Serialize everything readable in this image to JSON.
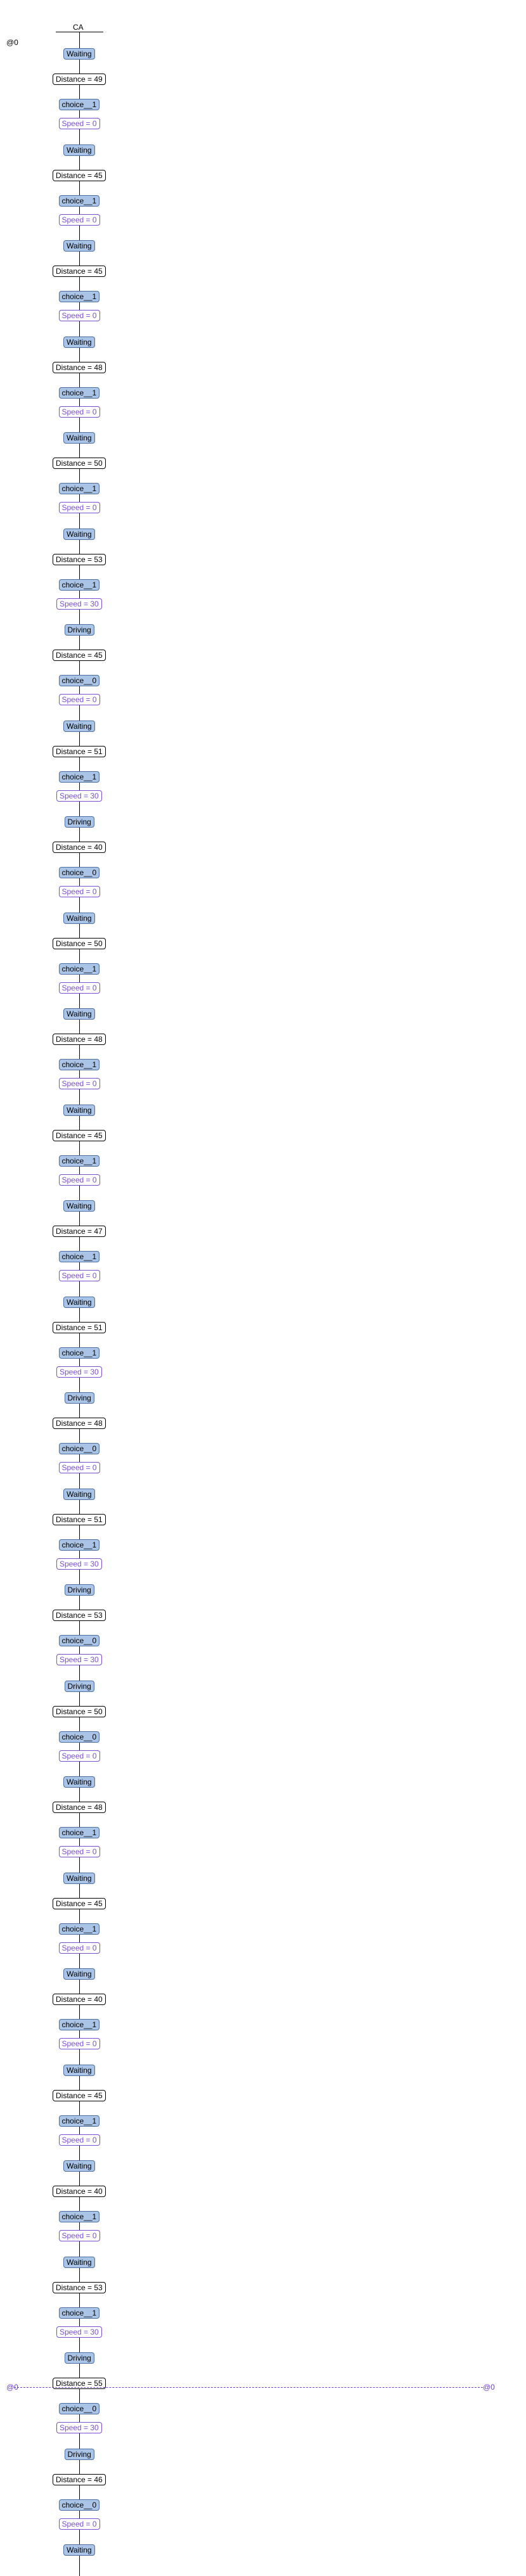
{
  "header": {
    "process": "CA",
    "clock_label": "@0"
  },
  "marker": {
    "left_label": "@0",
    "right_label": "@0"
  },
  "steps": [
    {
      "state": "Waiting",
      "guard": "Distance = 49",
      "choice": "choice__1",
      "assign": "Speed = 0"
    },
    {
      "state": "Waiting",
      "guard": "Distance = 45",
      "choice": "choice__1",
      "assign": "Speed = 0"
    },
    {
      "state": "Waiting",
      "guard": "Distance = 45",
      "choice": "choice__1",
      "assign": "Speed = 0"
    },
    {
      "state": "Waiting",
      "guard": "Distance = 48",
      "choice": "choice__1",
      "assign": "Speed = 0"
    },
    {
      "state": "Waiting",
      "guard": "Distance = 50",
      "choice": "choice__1",
      "assign": "Speed = 0"
    },
    {
      "state": "Waiting",
      "guard": "Distance = 53",
      "choice": "choice__1",
      "assign": "Speed = 30"
    },
    {
      "state": "Driving",
      "guard": "Distance = 45",
      "choice": "choice__0",
      "assign": "Speed = 0"
    },
    {
      "state": "Waiting",
      "guard": "Distance = 51",
      "choice": "choice__1",
      "assign": "Speed = 30"
    },
    {
      "state": "Driving",
      "guard": "Distance = 40",
      "choice": "choice__0",
      "assign": "Speed = 0"
    },
    {
      "state": "Waiting",
      "guard": "Distance = 50",
      "choice": "choice__1",
      "assign": "Speed = 0"
    },
    {
      "state": "Waiting",
      "guard": "Distance = 48",
      "choice": "choice__1",
      "assign": "Speed = 0"
    },
    {
      "state": "Waiting",
      "guard": "Distance = 45",
      "choice": "choice__1",
      "assign": "Speed = 0"
    },
    {
      "state": "Waiting",
      "guard": "Distance = 47",
      "choice": "choice__1",
      "assign": "Speed = 0"
    },
    {
      "state": "Waiting",
      "guard": "Distance = 51",
      "choice": "choice__1",
      "assign": "Speed = 30"
    },
    {
      "state": "Driving",
      "guard": "Distance = 48",
      "choice": "choice__0",
      "assign": "Speed = 0"
    },
    {
      "state": "Waiting",
      "guard": "Distance = 51",
      "choice": "choice__1",
      "assign": "Speed = 30"
    },
    {
      "state": "Driving",
      "guard": "Distance = 53",
      "choice": "choice__0",
      "assign": "Speed = 30"
    },
    {
      "state": "Driving",
      "guard": "Distance = 50",
      "choice": "choice__0",
      "assign": "Speed = 0"
    },
    {
      "state": "Waiting",
      "guard": "Distance = 48",
      "choice": "choice__1",
      "assign": "Speed = 0"
    },
    {
      "state": "Waiting",
      "guard": "Distance = 45",
      "choice": "choice__1",
      "assign": "Speed = 0"
    },
    {
      "state": "Waiting",
      "guard": "Distance = 40",
      "choice": "choice__1",
      "assign": "Speed = 0"
    },
    {
      "state": "Waiting",
      "guard": "Distance = 45",
      "choice": "choice__1",
      "assign": "Speed = 0"
    },
    {
      "state": "Waiting",
      "guard": "Distance = 40",
      "choice": "choice__1",
      "assign": "Speed = 0"
    },
    {
      "state": "Waiting",
      "guard": "Distance = 53",
      "choice": "choice__1",
      "assign": "Speed = 30"
    },
    {
      "state": "Driving",
      "guard": "Distance = 55",
      "choice": "choice__0",
      "assign": "Speed = 30"
    },
    {
      "state": "Driving",
      "guard": "Distance = 46",
      "choice": "choice__0",
      "assign": "Speed = 0"
    },
    {
      "state": "Waiting"
    }
  ]
}
